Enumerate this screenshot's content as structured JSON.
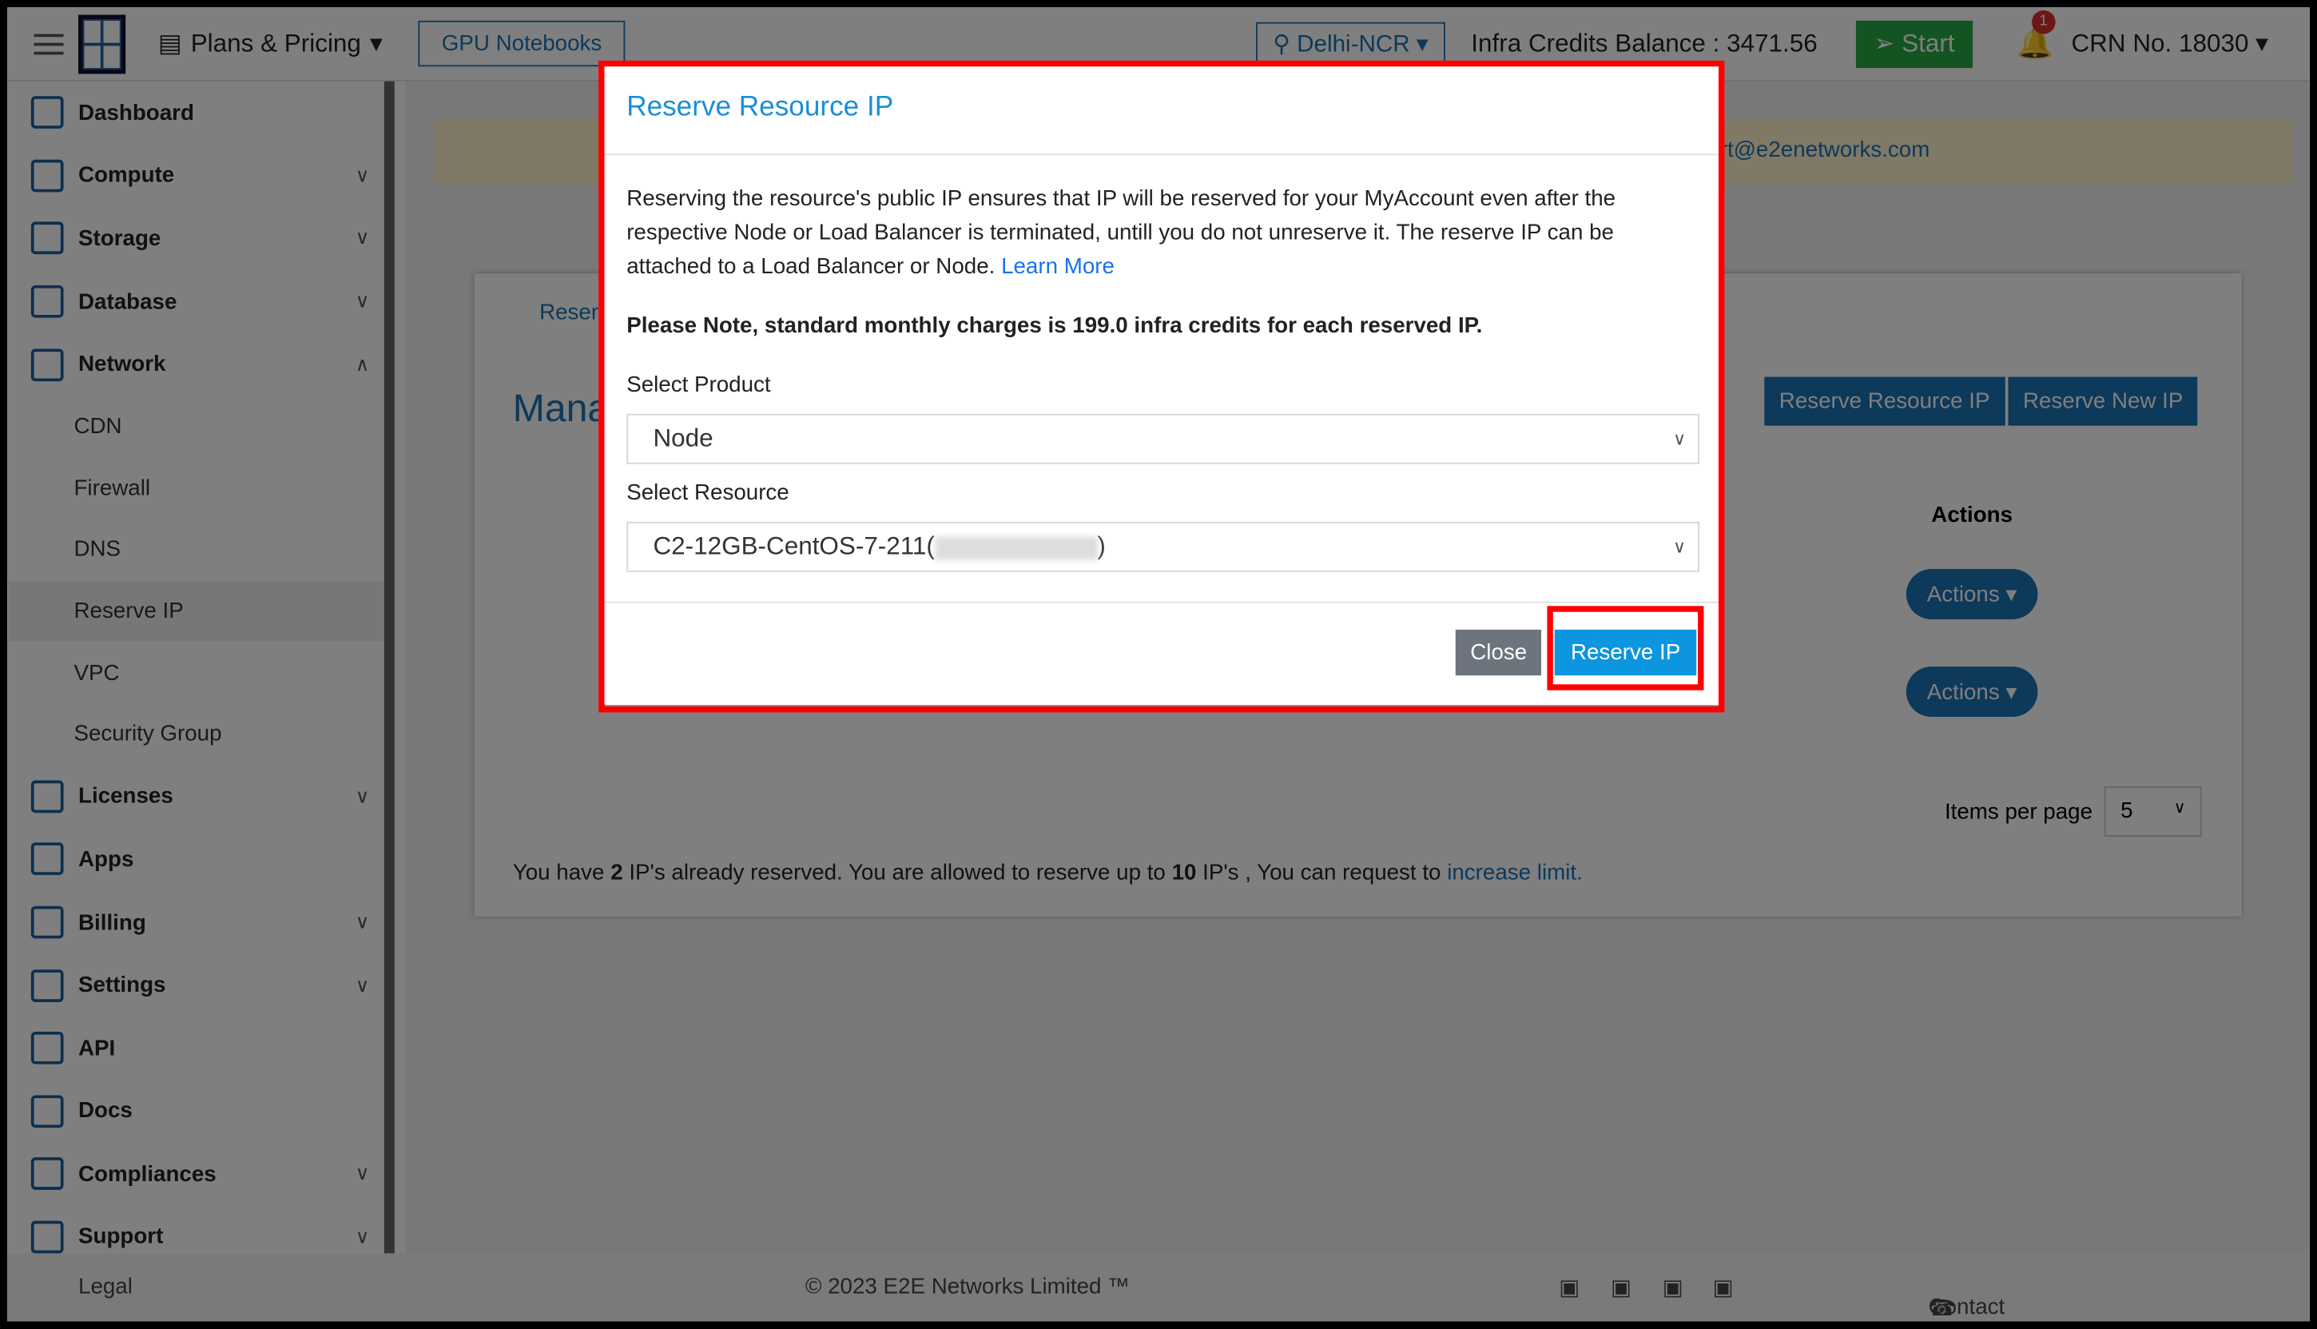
{
  "topbar": {
    "plans": "Plans & Pricing",
    "gpu": "GPU Notebooks",
    "region": "Delhi-NCR",
    "credits": "Infra Credits Balance : 3471.56",
    "start": "Start",
    "notifications": "1",
    "crn": "CRN No. 18030"
  },
  "sidebar": {
    "items": [
      {
        "label": "Dashboard"
      },
      {
        "label": "Compute"
      },
      {
        "label": "Storage"
      },
      {
        "label": "Database"
      },
      {
        "label": "Network"
      }
    ],
    "network_sub": [
      "CDN",
      "Firewall",
      "DNS",
      "Reserve IP",
      "VPC",
      "Security Group"
    ],
    "items2": [
      {
        "label": "Licenses"
      },
      {
        "label": "Apps"
      },
      {
        "label": "Billing"
      },
      {
        "label": "Settings"
      },
      {
        "label": "API"
      },
      {
        "label": "Docs"
      },
      {
        "label": "Compliances"
      },
      {
        "label": "Support"
      }
    ]
  },
  "main": {
    "alert_email": "rt@e2enetworks.com",
    "tab": "Reser",
    "title": "Mana",
    "reserve_resource_btn": "Reserve Resource IP",
    "reserve_new_btn": "Reserve New IP",
    "actions_header": "Actions",
    "actions_btn": "Actions",
    "items_per_page": "Items per page",
    "items_per_page_value": "5",
    "note_pre": "You have ",
    "note_count": "2",
    "note_mid": " IP's already reserved. You are allowed to reserve up to ",
    "note_limit": "10",
    "note_post": " IP's , You can request to ",
    "note_link": "increase limit."
  },
  "footer": {
    "legal": "Legal",
    "copyright": "© 2023 E2E Networks Limited ™",
    "contact": "Contact Us"
  },
  "modal": {
    "title": "Reserve Resource IP",
    "desc": "Reserving the resource's public IP ensures that IP will be reserved for your MyAccount even after the respective Node or Load Balancer is terminated, untill you do not unreserve it. The reserve IP can be attached to a Load Balancer or Node. ",
    "learn_more": "Learn More",
    "note": "Please Note, standard monthly charges is 199.0 infra credits for each reserved IP.",
    "product_label": "Select Product",
    "product_value": "Node",
    "resource_label": "Select Resource",
    "resource_value_prefix": "C2-12GB-CentOS-7-211(",
    "resource_value_suffix": ")",
    "close": "Close",
    "reserve": "Reserve IP"
  },
  "colors": {
    "accent": "#1a73b5",
    "highlight": "#ff0000",
    "primary_btn": "#0d96e0"
  }
}
